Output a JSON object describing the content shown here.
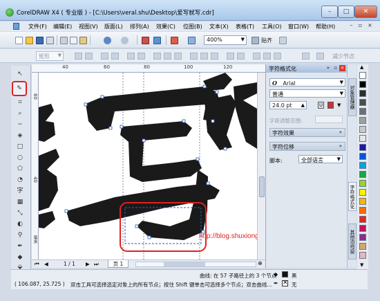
{
  "window": {
    "title": "CorelDRAW X4 ( 专业版 ) - [C:\\Users\\veral.shu\\Desktop\\爱写就写.cdr]",
    "min_glyph": "–",
    "max_glyph": "□",
    "close_glyph": "✕"
  },
  "menubar": {
    "items": [
      "文件(F)",
      "编辑(E)",
      "视图(V)",
      "版面(L)",
      "排列(A)",
      "效果(C)",
      "位图(B)",
      "文本(X)",
      "表格(T)",
      "工具(O)",
      "窗口(W)",
      "帮助(H)"
    ]
  },
  "toolbar": {
    "zoom": "400%",
    "snap_label": "贴齐"
  },
  "propbar": {
    "mode_select": "矩形",
    "reduce_nodes": "减少节点"
  },
  "rulers": {
    "top_ticks": [
      "40",
      "60",
      "80",
      "100",
      "120"
    ],
    "left_ticks": [
      "60",
      "40"
    ],
    "unit": "毫米"
  },
  "canvas": {
    "watermark": "http://blog.shuxiong.net"
  },
  "pagenav": {
    "page_count": "1 / 1",
    "page_tab": "页 1"
  },
  "docker": {
    "title": "字符格式化",
    "font_name": "Arial",
    "font_style": "普通",
    "font_size": "24.0 pt",
    "tracking_label": "字距调整范围:",
    "section_effects": "字符效果",
    "section_position": "字符位移",
    "script_label": "脚本:",
    "script_value": "全部语言",
    "tabs": [
      "对象管理器",
      "字符格式化",
      "其他泊坞窗"
    ]
  },
  "palette": {
    "colors": [
      "#ffffff",
      "#000000",
      "#2e2e2e",
      "#4d4d4d",
      "#707070",
      "#a0a0a0",
      "#c8c8c8",
      "#e6e6e6",
      "#1b1ba8",
      "#0057d8",
      "#00a3e0",
      "#18a84a",
      "#9bd22d",
      "#fff200",
      "#ffb400",
      "#ff6e00",
      "#e8231b",
      "#c2145c",
      "#8c2a8c",
      "#d7a46c",
      "#e8b4c0"
    ]
  },
  "status": {
    "curve_info": "曲线: 在 57 子路径上的 3 个节点",
    "coords": "( 106.087, 25.725 )",
    "hint": "双击工具可选择选定对象上的所有节点；按住 Shift 键单击可选择多个节点；双击曲线...",
    "fill_label": "黑",
    "outline_label": "无"
  }
}
